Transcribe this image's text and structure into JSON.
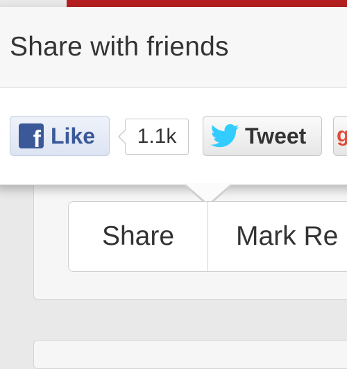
{
  "popover": {
    "title": "Share with friends"
  },
  "share_buttons": {
    "facebook": {
      "icon": "facebook-icon",
      "icon_glyph": "f",
      "label": "Like",
      "count": "1.1k",
      "color": "#3b5998"
    },
    "twitter": {
      "icon": "twitter-bird-icon",
      "label": "Tweet",
      "color": "#33ccff"
    },
    "google_plus": {
      "icon": "google-plus-icon",
      "icon_glyph": "g",
      "color": "#dd4b39"
    }
  },
  "actions": {
    "share_label": "Share",
    "mark_read_label": "Mark Re"
  },
  "colors": {
    "top_bar": "#b51f1f"
  }
}
